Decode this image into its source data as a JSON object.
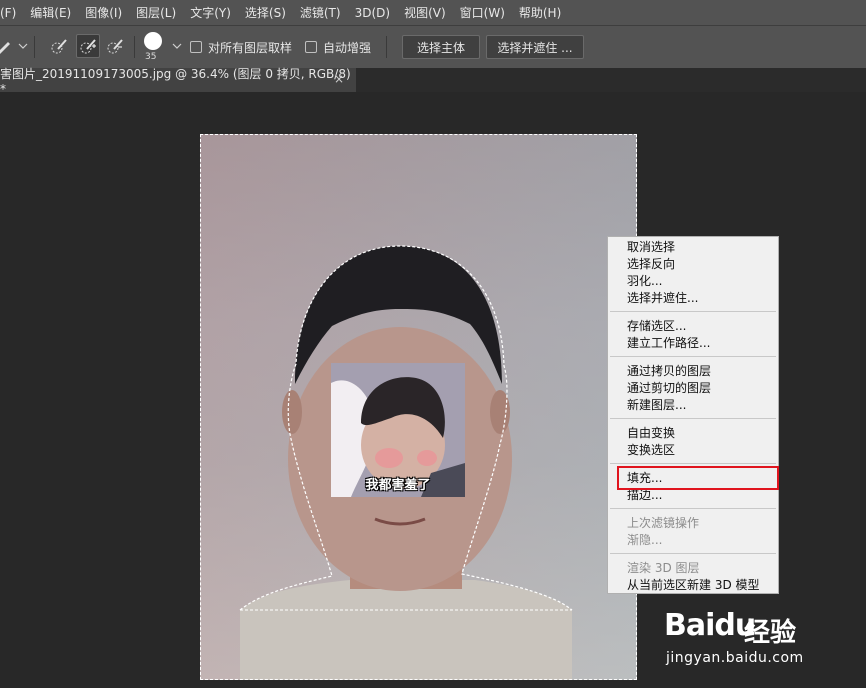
{
  "menu": [
    "(F)",
    "编辑(E)",
    "图像(I)",
    "图层(L)",
    "文字(Y)",
    "选择(S)",
    "滤镜(T)",
    "3D(D)",
    "视图(V)",
    "窗口(W)",
    "帮助(H)"
  ],
  "options": {
    "brush_size": "35",
    "sample_all_layers": "对所有图层取样",
    "auto_enhance": "自动增强",
    "select_subject": "选择主体",
    "select_and_mask": "选择并遮住 ..."
  },
  "tab": {
    "title": "害图片_20191109173005.jpg @ 36.4% (图层 0 拷贝, RGB/8) *",
    "close": "×"
  },
  "sticker": {
    "caption": "我都害羞了"
  },
  "context_menu": {
    "deselect": "取消选择",
    "select_inverse": "选择反向",
    "feather": "羽化...",
    "select_and_mask": "选择并遮住...",
    "save_selection": "存储选区...",
    "make_work_path": "建立工作路径...",
    "layer_via_copy": "通过拷贝的图层",
    "layer_via_cut": "通过剪切的图层",
    "new_layer": "新建图层...",
    "free_transform": "自由变换",
    "transform_selection": "变换选区",
    "fill": "填充...",
    "stroke": "描边...",
    "last_filter": "上次滤镜操作",
    "fade": "渐隐...",
    "render_3d": "渲染 3D 图层",
    "new_3d_model": "从当前选区新建 3D 模型"
  },
  "watermark": {
    "brand": "Baidu",
    "brand_cn": "经验",
    "url": "jingyan.baidu.com"
  },
  "colors": {
    "menu_bg": "#535353",
    "canvas_bg": "#282828",
    "highlight": "#e0141e",
    "context_bg": "#f0f0f0"
  }
}
